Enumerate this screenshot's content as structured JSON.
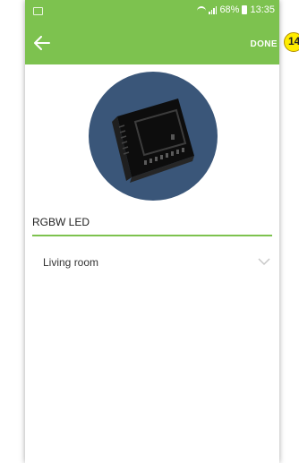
{
  "statusbar": {
    "battery": "68%",
    "time": "13:35"
  },
  "toolbar": {
    "done_label": "DONE"
  },
  "device": {
    "name_value": "RGBW LED"
  },
  "room": {
    "selected": "Living room"
  },
  "annotation": {
    "step": "14"
  },
  "colors": {
    "accent": "#7dc24f",
    "avatar_background": "#3a5679"
  },
  "icons": {
    "back": "arrow-left-icon",
    "dropdown": "chevron-down-icon"
  }
}
